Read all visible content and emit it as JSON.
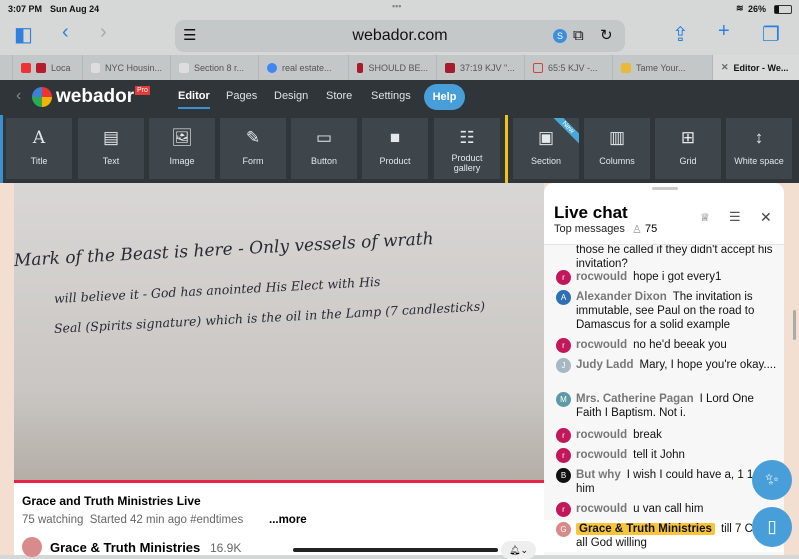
{
  "status": {
    "time": "3:07 PM",
    "date": "Sun Aug 24",
    "battery": "26%"
  },
  "browser": {
    "url": "webador.com"
  },
  "tabs": [
    {
      "label": "Loca",
      "color": "#b71c2c"
    },
    {
      "label": "NYC Housin...",
      "color": "#ddd"
    },
    {
      "label": "Section 8 r...",
      "color": "#ddd"
    },
    {
      "label": "real estate...",
      "color": "#4285f4"
    },
    {
      "label": "SHOULD BE...",
      "color": "#a51d2d"
    },
    {
      "label": "37:19 KJV \"...",
      "color": "#a51d2d"
    },
    {
      "label": "65:5 KJV -...",
      "color": "#c44"
    },
    {
      "label": "Tame Your...",
      "color": "#e9b93c"
    },
    {
      "label": "Editor - We...",
      "color": "#666"
    }
  ],
  "nav": {
    "logo": "webador",
    "pro": "Pro",
    "links": [
      "Editor",
      "Pages",
      "Design",
      "Store",
      "Settings"
    ],
    "help": "Help"
  },
  "tools": [
    {
      "label": "Title",
      "icon": "A"
    },
    {
      "label": "Text",
      "icon": "▤"
    },
    {
      "label": "Image",
      "icon": "🖼"
    },
    {
      "label": "Form",
      "icon": "✎"
    },
    {
      "label": "Button",
      "icon": "▭"
    },
    {
      "label": "Product",
      "icon": "■"
    },
    {
      "label": "Product gallery",
      "icon": "☷"
    },
    {
      "label": "Section",
      "icon": "▣",
      "badge": "New"
    },
    {
      "label": "Columns",
      "icon": "▥"
    },
    {
      "label": "Grid",
      "icon": "⊞"
    },
    {
      "label": "White space",
      "icon": "↕"
    }
  ],
  "whiteboard": [
    "Mark of the Beast is here - Only vessels of wrath",
    "will believe it - God has anointed His Elect with His",
    "Seal (Spirits signature) which is the oil in the Lamp (7 candlesticks)"
  ],
  "video": {
    "title": "Grace and Truth Ministries Live",
    "meta": "75 watching  Started 42 min ago #endtimes",
    "more": "...more",
    "channel": "Grace & Truth Ministries",
    "subs": "16.9K"
  },
  "chat": {
    "title": "Live chat",
    "mode": "Top messages",
    "viewers": "75",
    "messages": [
      {
        "author": "",
        "text": "those he called if they didn't accept his invitation?"
      },
      {
        "author": "rocwould",
        "text": "hope i got every1",
        "avatar": "r",
        "color": "#c2185b"
      },
      {
        "author": "Alexander Dixon",
        "text": "The invitation is immutable, see Paul on the road to Damascus for a solid example",
        "avatar": "A",
        "color": "#2f6fb5"
      },
      {
        "author": "rocwould",
        "text": "no he'd beeak you",
        "avatar": "r",
        "color": "#c2185b"
      },
      {
        "author": "Judy Ladd",
        "text": "Mary, I hope you're okay....",
        "avatar": "J",
        "color": "#a7b7c4"
      },
      {
        "author": "Mrs. Catherine Pagan",
        "text": "I Lord One Faith I Baptism. Not i.",
        "avatar": "M",
        "color": "#5d9aa8"
      },
      {
        "author": "rocwould",
        "text": "break",
        "avatar": "r",
        "color": "#c2185b"
      },
      {
        "author": "rocwould",
        "text": "tell it John",
        "avatar": "r",
        "color": "#c2185b"
      },
      {
        "author": "But why",
        "text": "I wish I could have a, 1 1 with him",
        "avatar": "B",
        "color": "#111"
      },
      {
        "author": "rocwould",
        "text": "u van call him",
        "avatar": "r",
        "color": "#c2185b"
      },
      {
        "author": "Grace & Truth Ministries",
        "text": "till 7 CST all God willing",
        "avatar": "G",
        "color": "#d98a8a",
        "owner": true
      }
    ]
  }
}
